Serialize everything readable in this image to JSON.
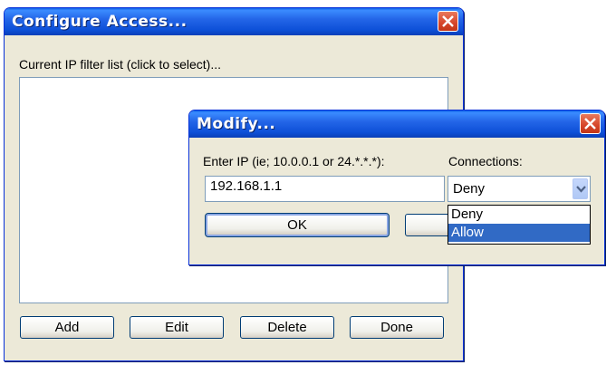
{
  "main_window": {
    "title": "Configure Access...",
    "list_label": "Current IP filter list (click to select)...",
    "buttons": {
      "add": "Add",
      "edit": "Edit",
      "delete": "Delete",
      "done": "Done"
    }
  },
  "modify_dialog": {
    "title": "Modify...",
    "ip_label": "Enter IP (ie; 10.0.0.1 or 24.*.*.*):",
    "ip_value": "192.168.1.1",
    "connections_label": "Connections:",
    "connections_selected": "Deny",
    "connections_options": [
      "Deny",
      "Allow"
    ],
    "ok_label": "OK"
  }
}
